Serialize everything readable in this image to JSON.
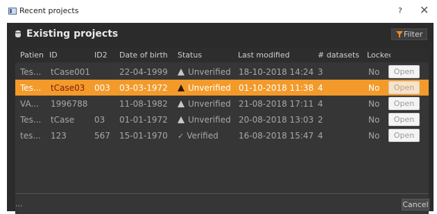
{
  "window": {
    "title": "Recent projects",
    "help_label": "?",
    "close_label": "✕"
  },
  "section": {
    "heading": "Existing projects",
    "filter_label": "Filter"
  },
  "table": {
    "headers": [
      "Patien",
      "ID",
      "ID2",
      "Date of birth",
      "Status",
      "Last modified",
      "# datasets",
      "Lockec"
    ],
    "rows": [
      {
        "patient": "Tes...",
        "id": "tCase001",
        "id2": "",
        "dob": "22-04-1999",
        "status": "Unverified",
        "modified": "18-10-2018 14:24",
        "datasets": "3",
        "locked": "No",
        "action": "Open"
      },
      {
        "patient": "Tes...",
        "id": "tCase03",
        "id2": "003",
        "dob": "03-03-1972",
        "status": "Unverified",
        "modified": "01-10-2018 11:38",
        "datasets": "4",
        "locked": "No",
        "action": "Open"
      },
      {
        "patient": "VA...",
        "id": "1996788",
        "id2": "",
        "dob": "11-08-1982",
        "status": "Unverified",
        "modified": "21-08-2018 17:11",
        "datasets": "4",
        "locked": "No",
        "action": "Open"
      },
      {
        "patient": "Tes...",
        "id": "tCase",
        "id2": "03",
        "dob": "01-01-1972",
        "status": "Unverified",
        "modified": "20-08-2018 13:03",
        "datasets": "2",
        "locked": "No",
        "action": "Open"
      },
      {
        "patient": "tes...",
        "id": "123",
        "id2": "567",
        "dob": "15-01-1970",
        "status": "Verified",
        "modified": "16-08-2018 15:47",
        "datasets": "4",
        "locked": "No",
        "action": "Open"
      }
    ]
  },
  "footer": {
    "ellipsis": "...",
    "cancel_label": "Cancel"
  },
  "colors": {
    "accent": "#f39a2b",
    "background": "#2b2b2b",
    "table_bg": "#363636",
    "filter_icon": "#f08a1c"
  },
  "icons": {
    "window": "app-window-icon",
    "section": "database-icon",
    "filter": "funnel-icon",
    "unverified": "warning-icon",
    "verified": "check-icon"
  }
}
